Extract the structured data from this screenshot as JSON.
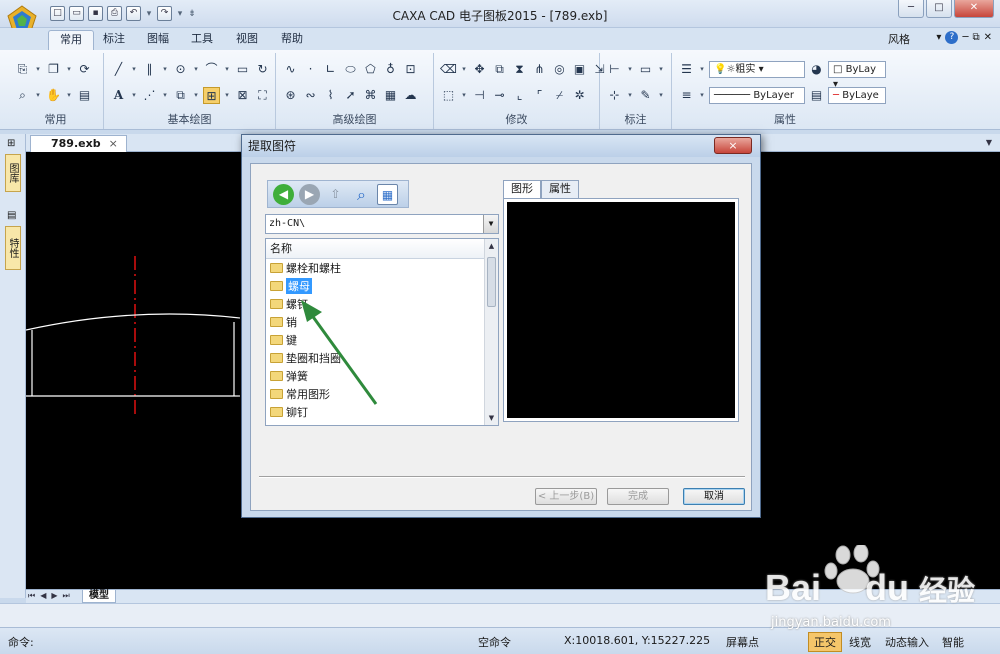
{
  "window": {
    "title": "CAXA CAD 电子图板2015 - [789.exb]"
  },
  "quick_access": [
    {
      "name": "new",
      "glyph": "□"
    },
    {
      "name": "open",
      "glyph": "▭"
    },
    {
      "name": "save",
      "glyph": "▪"
    },
    {
      "name": "print",
      "glyph": "⎙"
    },
    {
      "name": "undo",
      "glyph": "↶"
    },
    {
      "name": "redo",
      "glyph": "↷"
    }
  ],
  "menu_tabs": [
    "常用",
    "标注",
    "图幅",
    "工具",
    "视图",
    "帮助"
  ],
  "style_label": "风格",
  "ribbon": {
    "groups": [
      {
        "label": "常用"
      },
      {
        "label": "基本绘图"
      },
      {
        "label": "高级绘图"
      },
      {
        "label": "修改"
      },
      {
        "label": "标注"
      },
      {
        "label": "属性"
      }
    ],
    "properties": {
      "linewidth_combo": "粗实",
      "layer_combo": "ByLay",
      "linetype_combo": "ByLayer",
      "color_combo": "ByLaye"
    }
  },
  "document_tab": {
    "name": "789.exb",
    "close": "×"
  },
  "left_panels": [
    "图库",
    "特性"
  ],
  "model_tab": "模型",
  "status": {
    "command_prompt": "命令:",
    "state": "空命令",
    "coordinates": "X:10018.601, Y:15227.225",
    "screen_point": "屏幕点",
    "toggles": [
      "正交",
      "线宽",
      "动态输入",
      "智能"
    ]
  },
  "dialog": {
    "title": "提取图符",
    "close": "×",
    "path": "zh-CN\\",
    "list_header": "名称",
    "folders": [
      "螺栓和螺柱",
      "螺母",
      "螺钉",
      "销",
      "键",
      "垫圈和挡圈",
      "弹簧",
      "常用图形",
      "铆钉"
    ],
    "selected_folder": "螺母",
    "preview_tabs": [
      "图形",
      "属性"
    ],
    "buttons": {
      "back": "< 上一步(B)",
      "finish": "完成",
      "cancel": "取消"
    }
  },
  "watermark": {
    "brand": "Bai",
    "brand2": "du",
    "cn": "经验",
    "url": "jingyan.baidu.com"
  },
  "colors": {
    "canvas": "#000000",
    "accent": "#2d6ec9",
    "annotation_arrow": "#2f8a3c",
    "centerline": "#e01010"
  }
}
